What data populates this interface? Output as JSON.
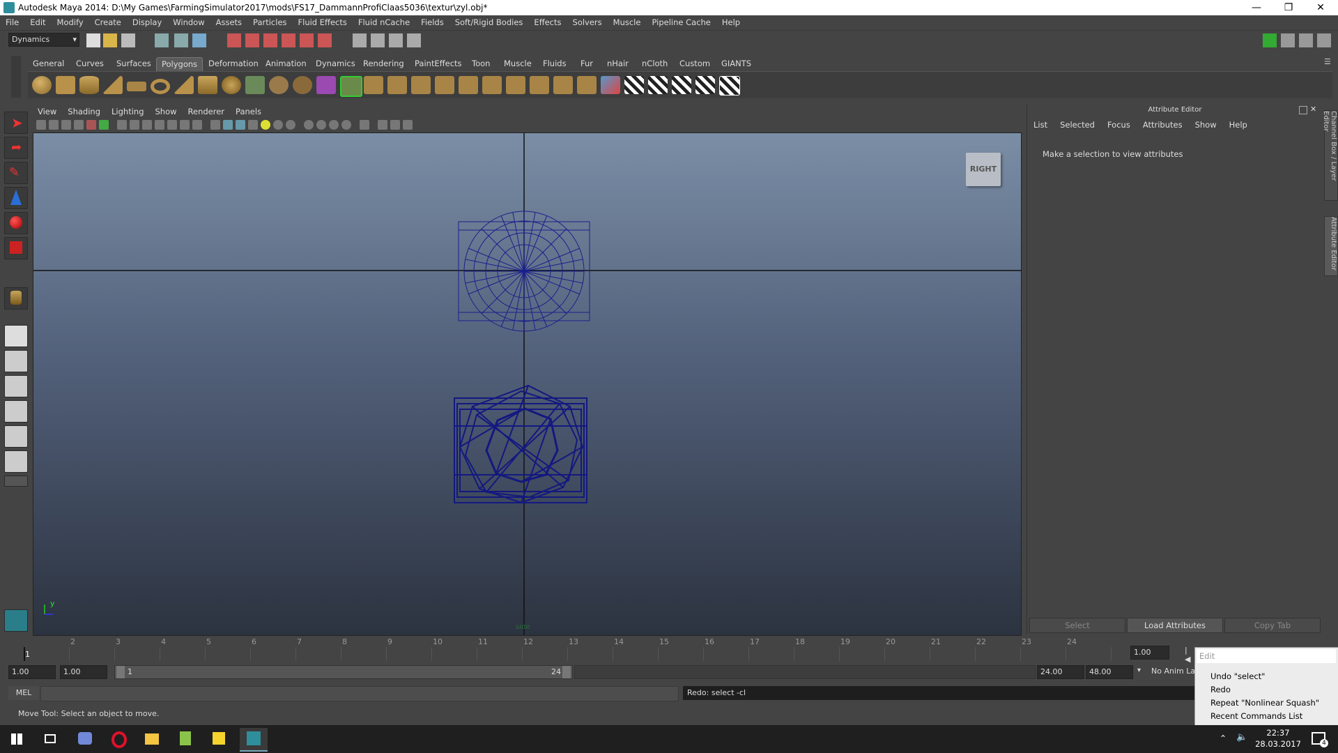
{
  "window": {
    "title": "Autodesk Maya 2014: D:\\My Games\\FarmingSimulator2017\\mods\\FS17_DammannProfiClaas5036\\textur\\zyl.obj*",
    "minimize_icon": "minimize-icon",
    "restore_icon": "restore-icon",
    "close_icon": "close-icon"
  },
  "menubar": [
    "File",
    "Edit",
    "Modify",
    "Create",
    "Display",
    "Window",
    "Assets",
    "Particles",
    "Fluid Effects",
    "Fluid nCache",
    "Fields",
    "Soft/Rigid Bodies",
    "Effects",
    "Solvers",
    "Muscle",
    "Pipeline Cache",
    "Help"
  ],
  "statusline": {
    "menu_set": "Dynamics"
  },
  "shelf": {
    "tabs": [
      "General",
      "Curves",
      "Surfaces",
      "Polygons",
      "Deformation",
      "Animation",
      "Dynamics",
      "Rendering",
      "PaintEffects",
      "Toon",
      "Muscle",
      "Fluids",
      "Fur",
      "nHair",
      "nCloth",
      "Custom",
      "GIANTS"
    ],
    "active_tab": "Polygons"
  },
  "viewport": {
    "menu": [
      "View",
      "Shading",
      "Lighting",
      "Show",
      "Renderer",
      "Panels"
    ],
    "view_cube_label": "RIGHT",
    "camera_label": "side",
    "axis_label": "y"
  },
  "attribute_editor": {
    "header": "Attribute Editor",
    "menu": [
      "List",
      "Selected",
      "Focus",
      "Attributes",
      "Show",
      "Help"
    ],
    "message": "Make a selection to view attributes",
    "buttons": {
      "select": "Select",
      "load": "Load Attributes",
      "copy_tab": "Copy Tab"
    },
    "side_tabs": [
      "Channel Box / Layer Editor",
      "Attribute Editor"
    ]
  },
  "timeslider": {
    "ticks": [
      "1",
      "2",
      "3",
      "4",
      "5",
      "6",
      "7",
      "8",
      "9",
      "10",
      "11",
      "12",
      "13",
      "14",
      "15",
      "16",
      "17",
      "18",
      "19",
      "20",
      "21",
      "22",
      "23",
      "24"
    ],
    "current_frame": "1",
    "current_time_field": "1.00"
  },
  "range": {
    "start": "1.00",
    "playback_start": "1.00",
    "slider_start": "1",
    "slider_end": "24",
    "playback_end": "24.00",
    "end": "48.00",
    "anim_layer": "No Anim Lay"
  },
  "command_line": {
    "label": "MEL",
    "input": "",
    "result": "Redo: select -cl"
  },
  "help_line": "Move Tool: Select an object to move.",
  "popup": {
    "edit_placeholder": "Edit",
    "items": [
      "Undo \"select\"",
      "Redo",
      "Repeat \"Nonlinear Squash\"",
      "Recent Commands List"
    ]
  },
  "taskbar": {
    "time": "22:37",
    "date": "28.03.2017",
    "notification_count": "4"
  },
  "colors": {
    "wireframe": "#1a1f8c",
    "viewport_top": "#7b8ea6",
    "viewport_bottom": "#2c3340"
  }
}
